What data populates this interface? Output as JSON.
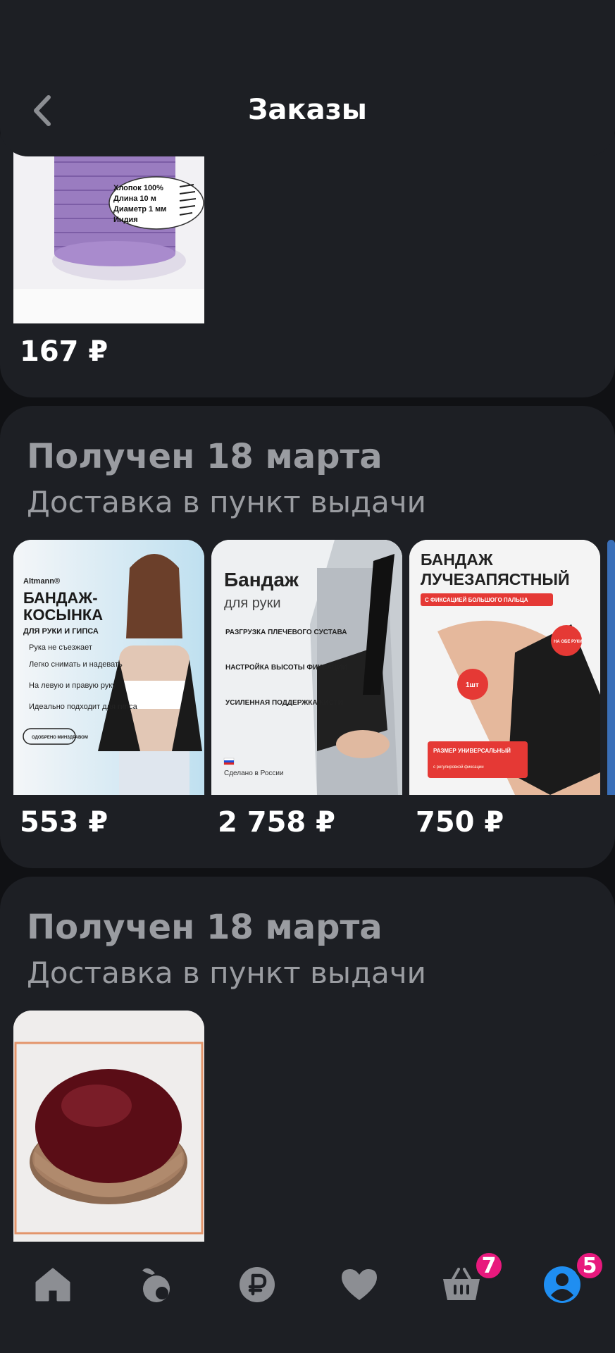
{
  "header": {
    "title": "Заказы"
  },
  "orders": [
    {
      "items": [
        {
          "price": "167 ₽",
          "label_lines": [
            "Хлопок 100%",
            "Длина 10 м",
            "Диаметр 1 мм",
            "Индия"
          ]
        }
      ]
    },
    {
      "status": "Получен 18 марта",
      "delivery": "Доставка в пункт выдачи",
      "items": [
        {
          "price": "553 ₽",
          "brand": "Altmann®",
          "title_lines": [
            "БАНДАЖ-",
            "КОСЫНКА"
          ],
          "sub": "ДЛЯ РУКИ И ГИПСА",
          "bullets": [
            "Рука не съезжает",
            "Легко снимать и надевать",
            "На левую и правую руку",
            "Идеально подходит для гипса"
          ],
          "stamp": "ОДОБРЕНО МИНЗДРАВОМ"
        },
        {
          "price": "2 758 ₽",
          "title": "Бандаж",
          "sub": "для руки",
          "bullets": [
            "РАЗГРУЗКА ПЛЕЧЕВОГО СУСТАВА",
            "НАСТРОЙКА ВЫСОТЫ ФИКСАЦИИ",
            "УСИЛЕННАЯ ПОДДЕРЖКА КИСТИ"
          ],
          "made": "Сделано в России"
        },
        {
          "price": "750 ₽",
          "title_lines": [
            "БАНДАЖ",
            "ЛУЧЕЗАПЯСТНЫЙ"
          ],
          "ribbon": "С ФИКСАЦИЕЙ БОЛЬШОГО ПАЛЬЦА",
          "circle": "НА ОБЕ РУКИ",
          "qty": "1шт",
          "size_title": "РАЗМЕР УНИВЕРСАЛЬНЫЙ",
          "size_sub": "с регулировкой фиксации"
        }
      ]
    },
    {
      "status": "Получен 18 марта",
      "delivery": "Доставка в пункт выдачи",
      "items": [
        {}
      ]
    }
  ],
  "nav": {
    "cart_badge": "7",
    "profile_badge": "5"
  },
  "colors": {
    "background": "#101114",
    "card": "#1d1f24",
    "muted": "#9a9ca1",
    "accent": "#1f8ef1",
    "badge": "#e8197d"
  }
}
